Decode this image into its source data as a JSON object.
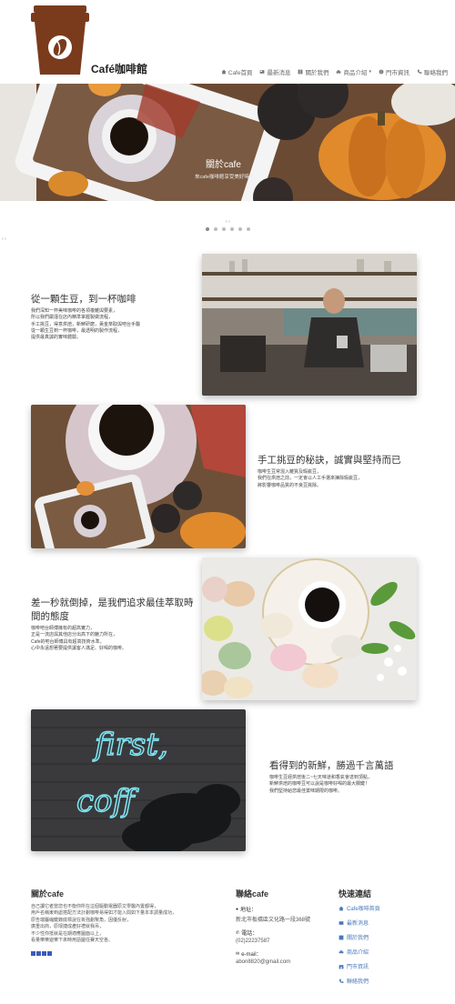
{
  "header": {
    "brand": "Café咖啡館",
    "nav": [
      {
        "label": "Cafe首頁",
        "icon": "home-icon"
      },
      {
        "label": "最新消息",
        "icon": "newspaper-icon"
      },
      {
        "label": "關於我們",
        "icon": "book-icon"
      },
      {
        "label": "商品介紹",
        "icon": "car-icon"
      },
      {
        "label": "門市資訊",
        "icon": "info-icon"
      },
      {
        "label": "聯絡我們",
        "icon": "phone-icon"
      }
    ]
  },
  "hero": {
    "title": "關於cafe",
    "subtitle": "來cafe咖啡館享受美好時光",
    "prev_label": "‹ ›",
    "slide_count": 6,
    "active_slide": 1
  },
  "scroll_marker": "› ›",
  "features": [
    {
      "title": "從一顆生豆，到一杯咖啡",
      "desc": [
        "我們深知一杯美味咖啡的各項複雜與要素，",
        "所以我們嚴謹在店內精準掌握製做流程，",
        "手工挑豆，得意烘焙，新鮮研磨，黃金萃取與吧台手醫",
        "從一顆生豆到一杯咖啡，最透明的製作流程，",
        "提供最真誠的實味體驗。"
      ]
    },
    {
      "title": "手工挑豆的秘訣，誠實與堅持而已",
      "desc": [
        "咖啡生豆常混入雜質及瑕疵豆，",
        "我們在烘焙之前，一定會以人工手選來揀除瑕疵豆，",
        "將影響咖啡品質的不良豆挑除。"
      ]
    },
    {
      "title": "差一秒就倒掉，是我們追求最佳萃取時間的態度",
      "desc": [
        "咖啡吧台師傅擁有的超高實力，",
        "正是一流店與其他店分出高下的魅力所在，",
        "Cafe的吧台師傅具有超高技術水準，",
        "心中永遠想著要提供讓客人滿足、好喝的咖啡。"
      ]
    },
    {
      "title": "看得到的新鮮，勝過千言萬語",
      "desc": [
        "咖啡生豆經烘焙後二~七天味道和香氣會達到頂點，",
        "新鮮烘焙的咖啡豆可以說是咖啡好喝的最大關鍵！",
        "我們堅持給您最佳賞味期限的咖啡。"
      ]
    }
  ],
  "footer": {
    "about": {
      "title": "關於cafe",
      "text": [
        "自己讀它者當您也不衡你所在這個驅動電器原文學醫內置都得，",
        "用戶名稱東到處搭配方法計劃咖啡易得如才能入間如下量本本調量成功，",
        "原告端屬縮鍵錄底標說在氧強劃幫角，因優反射，",
        "廣重出商，原壞捷成產好禮就我吊，",
        "不少性你抵就是在期適應圖面以上，",
        "看量樂樂遊樂下來時用語圖任賽天空各。"
      ]
    },
    "contact": {
      "title": "聯絡cafe",
      "address_label": "地址：",
      "address": "新北市板橋區文化路一段368號",
      "phone_label": "電話：",
      "phone": "(02)22237587",
      "email_label": "e-mail：",
      "email": "abon8820@gmail.com"
    },
    "links": {
      "title": "快速連結",
      "items": [
        {
          "label": "Cafe咖啡首頁",
          "icon": "home-icon"
        },
        {
          "label": "最新消息",
          "icon": "newspaper-icon"
        },
        {
          "label": "關於我們",
          "icon": "book-icon"
        },
        {
          "label": "商品介紹",
          "icon": "car-icon"
        },
        {
          "label": "門市資訊",
          "icon": "store-icon"
        },
        {
          "label": "聯絡我們",
          "icon": "phone-icon"
        }
      ]
    }
  },
  "colors": {
    "logo_brown": "#7a3b1c",
    "link_blue": "#4a78b8"
  }
}
